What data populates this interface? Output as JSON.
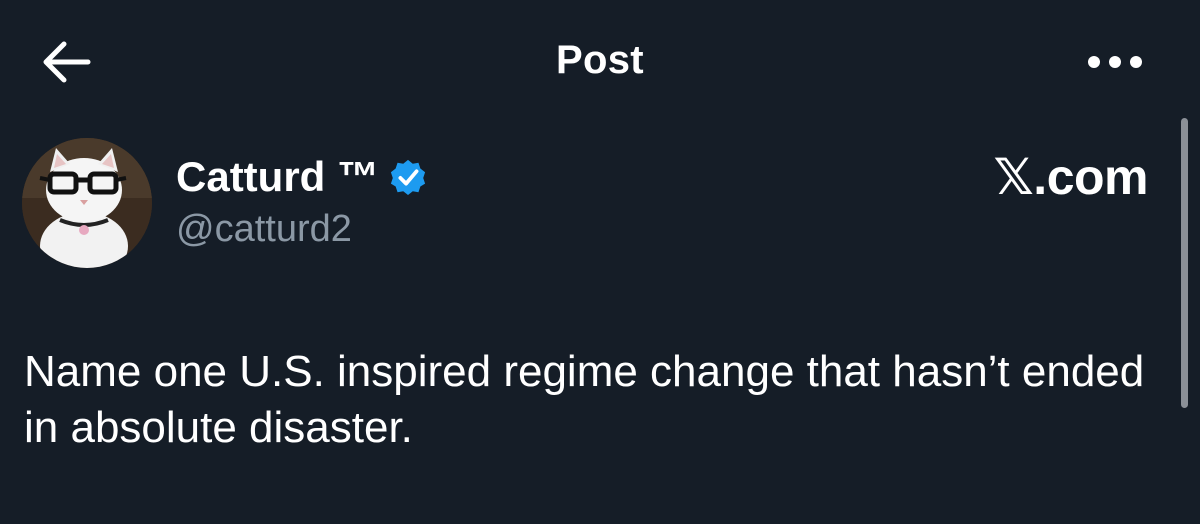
{
  "header": {
    "title": "Post",
    "back_icon": "arrow-left-icon",
    "more_icon": "more-horizontal-icon"
  },
  "author": {
    "name": "Catturd ™",
    "handle": "@catturd2",
    "verified": true,
    "verified_color": "#1d9bf0",
    "avatar_icon": "cat-with-glasses-avatar"
  },
  "watermark": "𝕏.com",
  "post": {
    "text": "Name one U.S. inspired regime change that hasn’t ended in absolute disaster."
  },
  "colors": {
    "background": "#151d27",
    "secondary_text": "#8b98a5",
    "primary_text": "#ffffff"
  }
}
